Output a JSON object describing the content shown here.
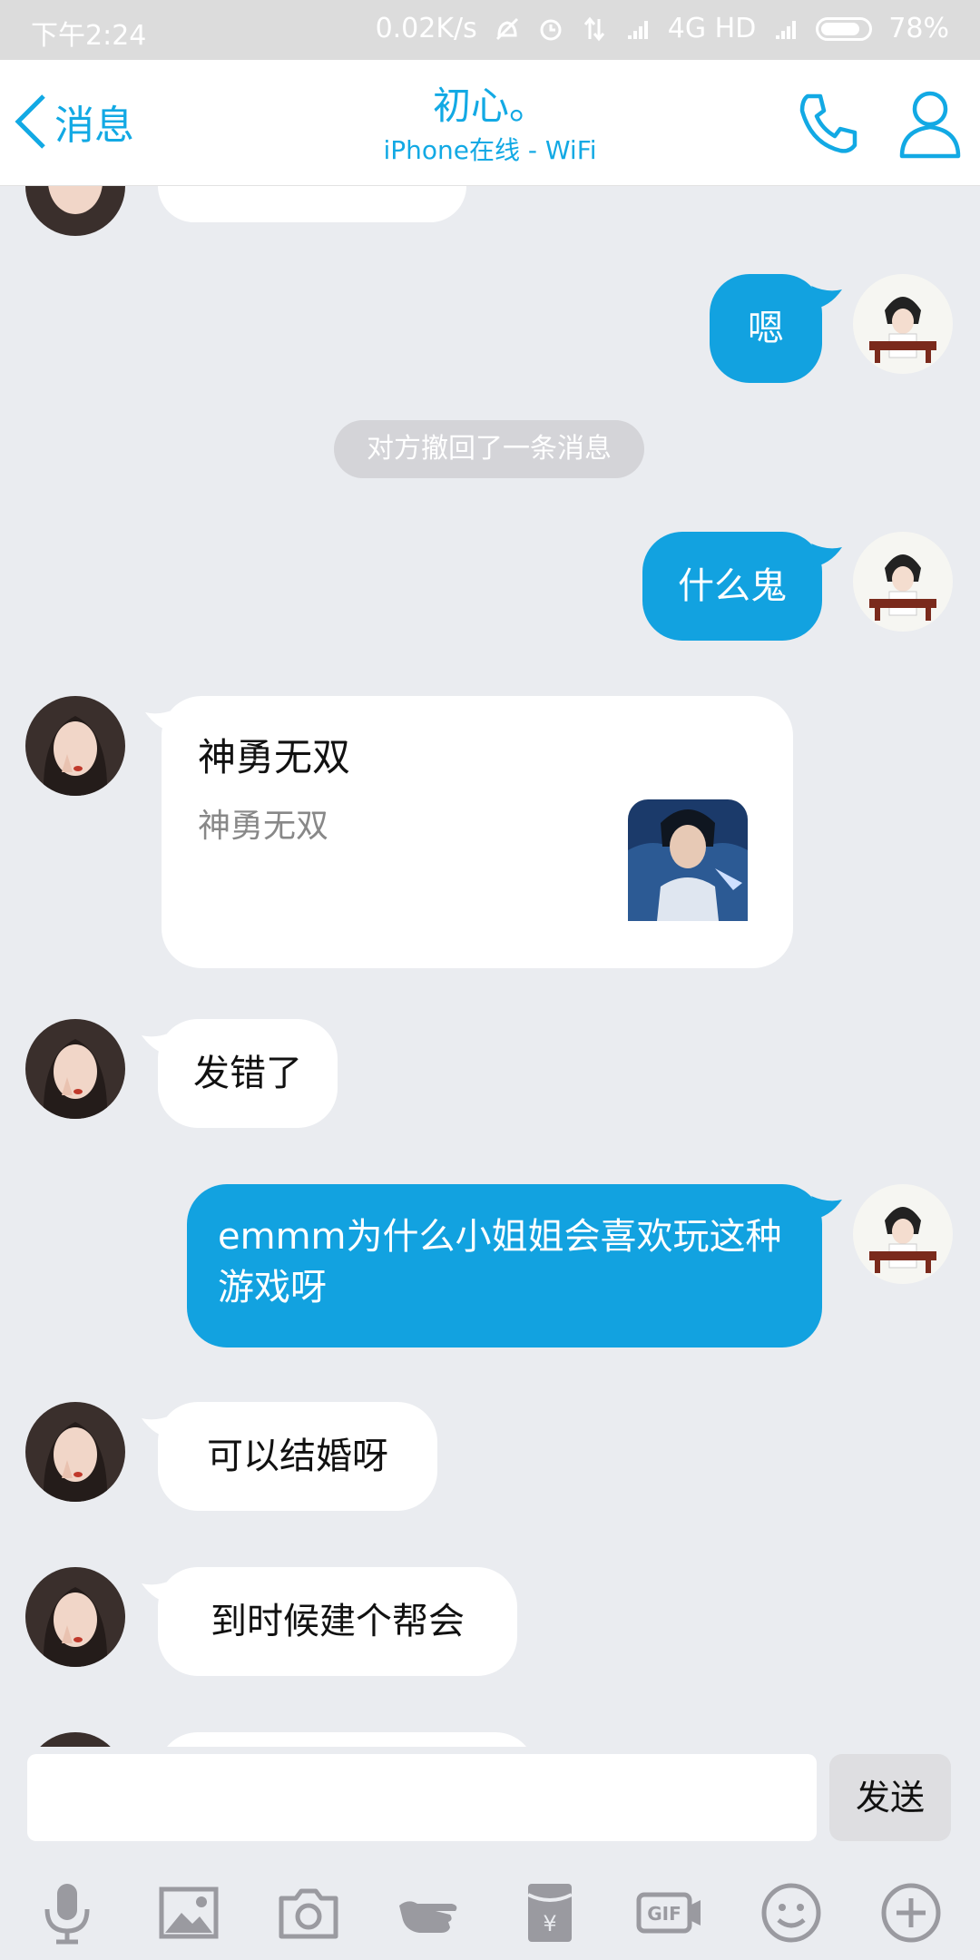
{
  "status_bar": {
    "time": "下午2:24",
    "network_speed": "0.02K/s",
    "network": "4G HD",
    "battery": "78%"
  },
  "header": {
    "back_label": "消息",
    "title": "初心。",
    "subtitle": "iPhone在线 - WiFi"
  },
  "colors": {
    "accent": "#12a2e0",
    "background": "#eaecf0",
    "incoming_bubble": "#ffffff"
  },
  "messages": [
    {
      "side": "out",
      "text": "嗯"
    },
    {
      "side": "system",
      "text": "对方撤回了一条消息"
    },
    {
      "side": "out",
      "text": "什么鬼"
    },
    {
      "side": "in",
      "type": "card",
      "title": "神勇无双",
      "subtitle": "神勇无双"
    },
    {
      "side": "in",
      "text": "发错了"
    },
    {
      "side": "out",
      "text": "emmm为什么小姐姐会喜欢玩这种游戏呀"
    },
    {
      "side": "in",
      "text": "可以结婚呀"
    },
    {
      "side": "in",
      "text": "到时候建个帮会"
    }
  ],
  "input": {
    "value": "",
    "send_label": "发送"
  },
  "toolbar": [
    "microphone-icon",
    "image-icon",
    "camera-icon",
    "poke-icon",
    "red-packet-icon",
    "gif-icon",
    "emoji-icon",
    "plus-icon"
  ]
}
